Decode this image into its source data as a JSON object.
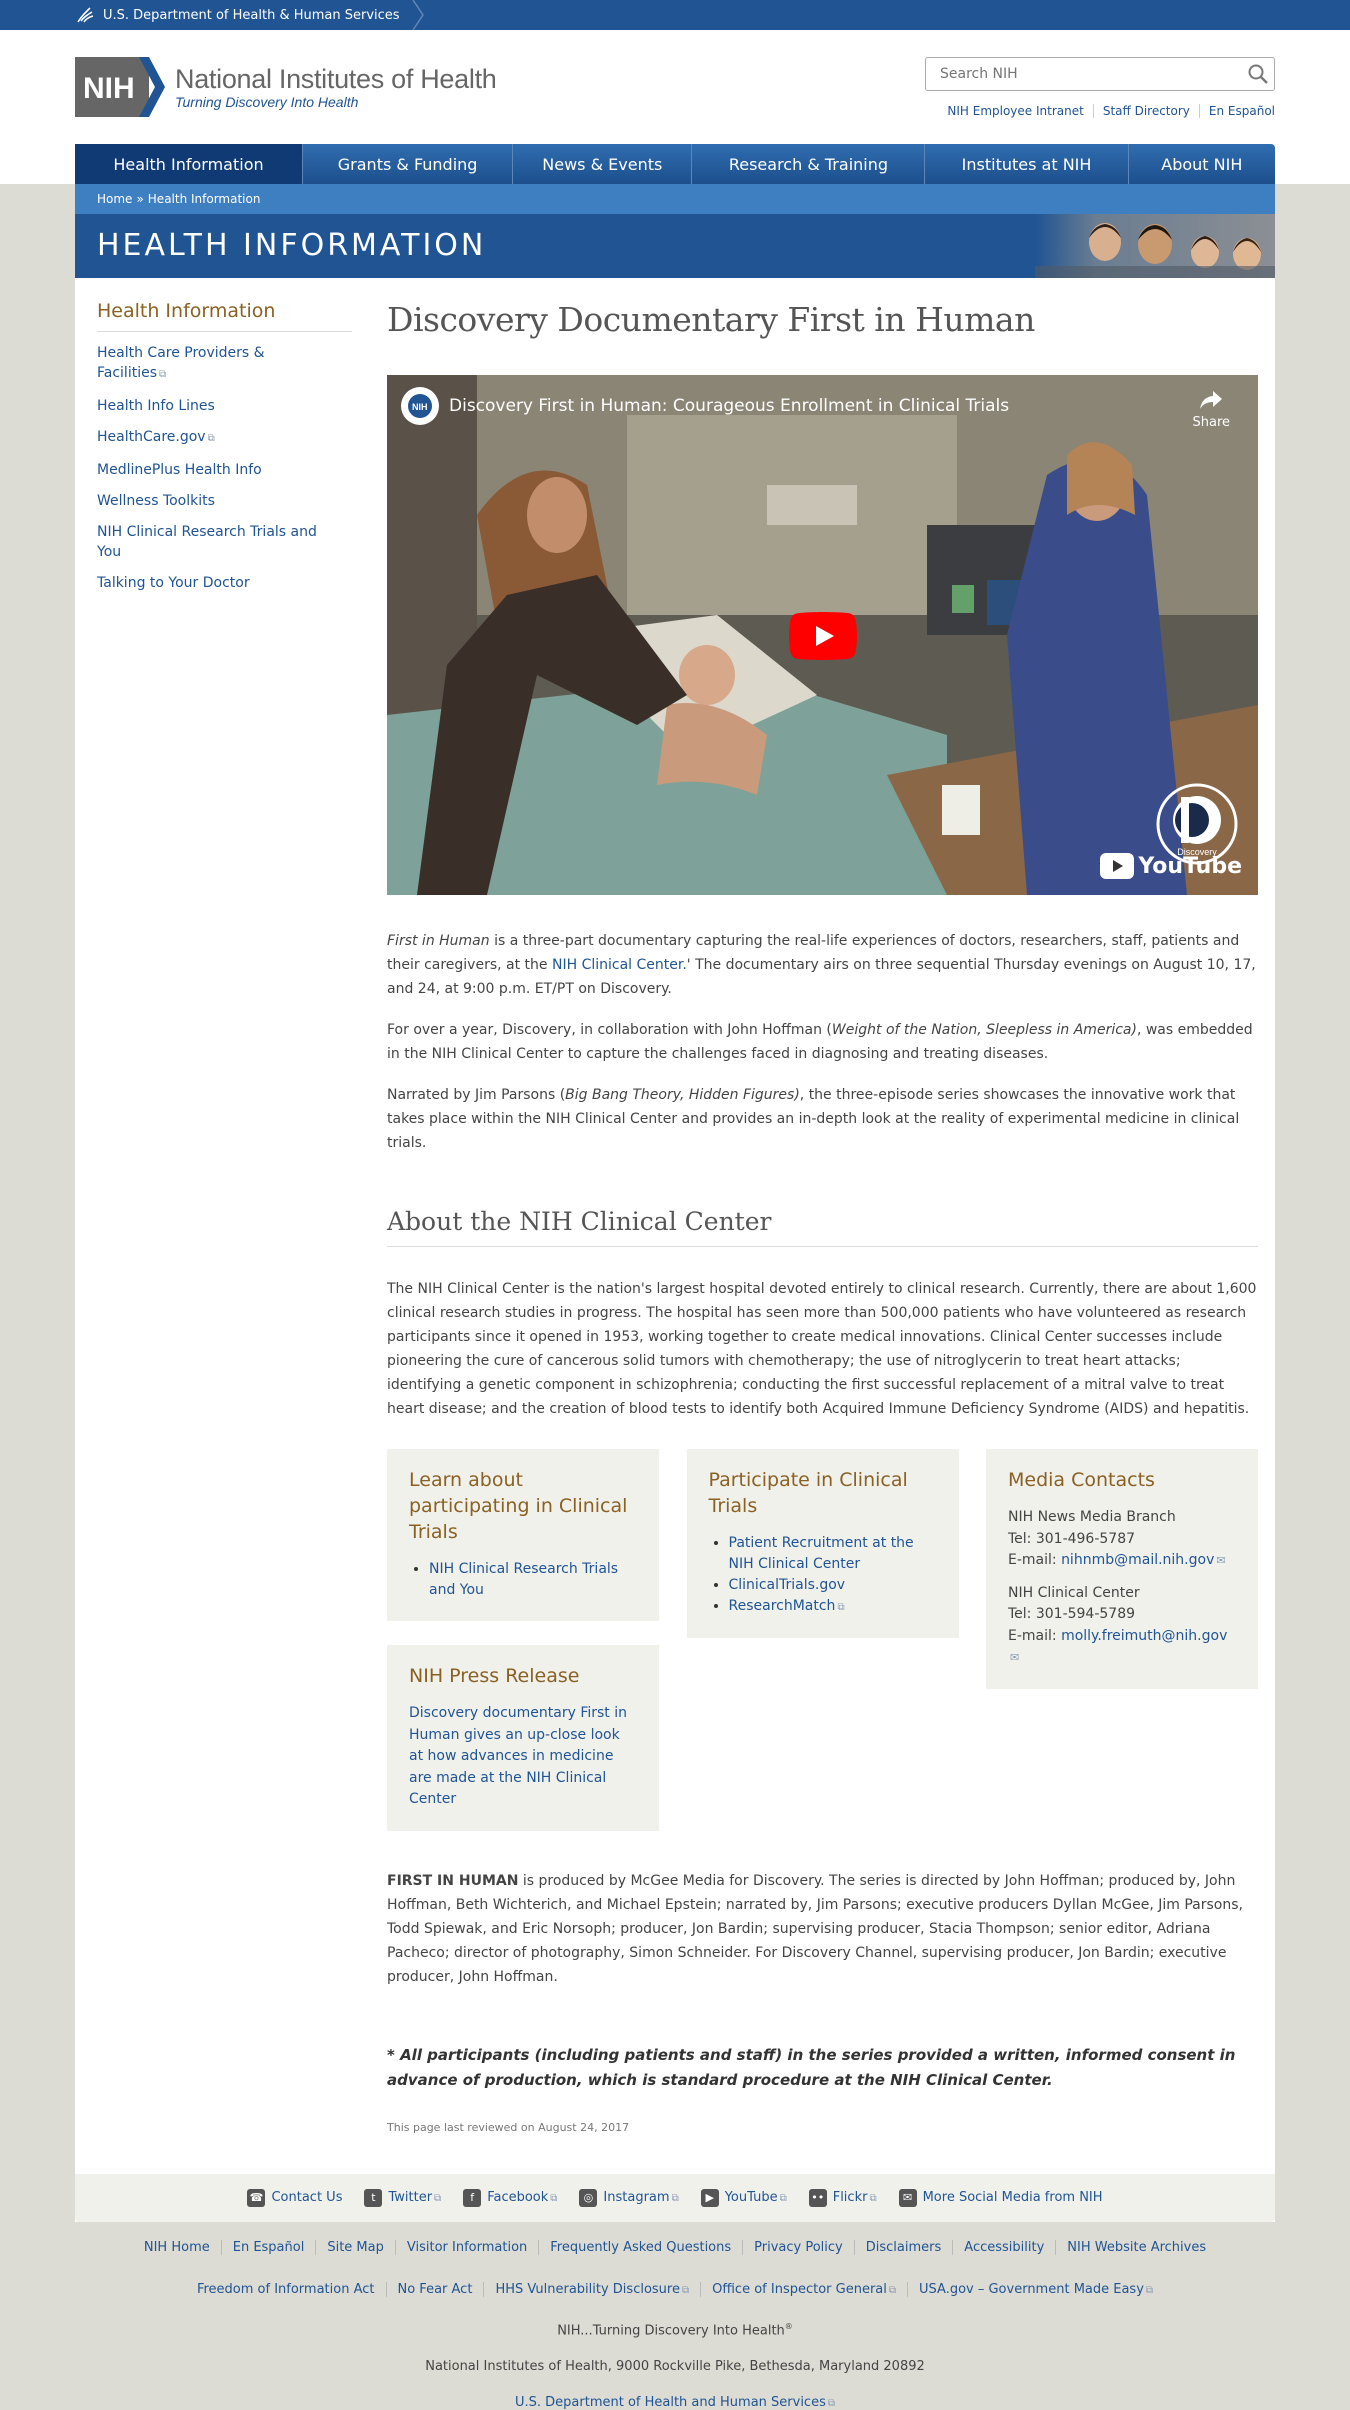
{
  "hhs_bar": {
    "label": "U.S. Department of Health & Human Services"
  },
  "header": {
    "logo_abbr": "NIH",
    "logo_title": "National Institutes of Health",
    "logo_tagline": "Turning Discovery Into Health",
    "search_placeholder": "Search NIH",
    "util_links": [
      "NIH Employee Intranet",
      "Staff Directory",
      "En Español"
    ]
  },
  "nav": {
    "items": [
      "Health Information",
      "Grants & Funding",
      "News & Events",
      "Research & Training",
      "Institutes at NIH",
      "About NIH"
    ],
    "active": "Health Information"
  },
  "breadcrumb": {
    "home": "Home",
    "separator": "»",
    "current": "Health Information"
  },
  "banner": {
    "title": "HEALTH INFORMATION"
  },
  "sidebar": {
    "title": "Health Information",
    "items": [
      {
        "label": "Health Care Providers & Facilities",
        "external": true
      },
      {
        "label": "Health Info Lines",
        "external": false
      },
      {
        "label": "HealthCare.gov",
        "external": true
      },
      {
        "label": "MedlinePlus Health Info",
        "external": false
      },
      {
        "label": "Wellness Toolkits",
        "external": false
      },
      {
        "label": "NIH Clinical Research Trials and You",
        "external": false
      },
      {
        "label": "Talking to Your Doctor",
        "external": false
      }
    ]
  },
  "main": {
    "title": "Discovery Documentary First in Human",
    "video": {
      "title": "Discovery First in Human: Courageous Enrollment in Clinical Trials",
      "share_label": "Share",
      "channel_badge": "Discovery",
      "youtube_label": "YouTube"
    },
    "p1": {
      "italic": "First in Human",
      "text1": " is a three-part documentary capturing the real-life experiences of doctors, researchers, staff, patients and their caregivers, at the ",
      "link": "NIH Clinical Center.",
      "text2": "' The documentary airs on three sequential Thursday evenings on August 10, 17, and 24, at 9:00 p.m. ET/PT on Discovery."
    },
    "p2": {
      "text1": "For over a year, Discovery, in collaboration with John Hoffman (",
      "italic": "Weight of the Nation, Sleepless in America)",
      "text2": ", was embedded in the NIH Clinical Center to capture the challenges faced in diagnosing and treating diseases."
    },
    "p3": {
      "text1": "Narrated by Jim Parsons (",
      "italic": "Big Bang Theory, Hidden Figures)",
      "text2": ", the three-episode series showcases the innovative work that takes place within the NIH Clinical Center and provides an in-depth look at the reality of experimental medicine in clinical trials."
    },
    "about_heading": "About the NIH Clinical Center",
    "about_text": "The NIH Clinical Center is the nation's largest hospital devoted entirely to clinical research. Currently, there are about 1,600 clinical research studies in progress. The hospital has seen more than 500,000 patients who have volunteered as research participants since it opened in 1953, working together to create medical innovations. Clinical Center successes include pioneering the cure of cancerous solid tumors with chemotherapy; the use of nitroglycerin to treat heart attacks; identifying a genetic component in schizophrenia; conducting the first successful replacement of a mitral valve to treat heart disease; and the creation of blood tests to identify both Acquired Immune Deficiency Syndrome (AIDS) and hepatitis.",
    "box_learn": {
      "title": "Learn about participating in Clinical Trials",
      "links": [
        "NIH Clinical Research Trials and You"
      ]
    },
    "box_press": {
      "title": "NIH Press Release",
      "link": "Discovery documentary First in Human gives an up-close look at how advances in medicine are made at the NIH Clinical Center"
    },
    "box_participate": {
      "title": "Participate in Clinical Trials",
      "links": [
        {
          "label": "Patient Recruitment at the NIH Clinical Center",
          "external": false
        },
        {
          "label": "ClinicalTrials.gov",
          "external": false
        },
        {
          "label": "ResearchMatch",
          "external": true
        }
      ]
    },
    "box_media": {
      "title": "Media Contacts",
      "contacts": [
        {
          "name": "NIH News Media Branch",
          "tel": "Tel: 301-496-5787",
          "email_label": "E-mail: ",
          "email": "nihnmb@mail.nih.gov"
        },
        {
          "name": "NIH Clinical Center",
          "tel": "Tel: 301-594-5789",
          "email_label": "E-mail: ",
          "email": "molly.freimuth@nih.gov"
        }
      ]
    },
    "credits": {
      "bold": "FIRST IN HUMAN",
      "text": " is produced by McGee Media for Discovery. The series is directed by John Hoffman; produced by, John Hoffman, Beth Wichterich, and Michael Epstein; narrated by, Jim Parsons; executive producers Dyllan McGee, Jim Parsons, Todd Spiewak, and Eric Norsoph; producer, Jon Bardin; supervising producer, Stacia Thompson; senior editor, Adriana Pacheco; director of photography, Simon Schneider. For Discovery Channel, supervising producer, Jon Bardin; executive producer, John Hoffman."
    },
    "disclaimer": "* All participants (including patients and staff) in the series provided a written, informed consent in advance of production, which is standard procedure at the NIH Clinical Center.",
    "reviewed": "This page last reviewed on August 24, 2017"
  },
  "social": {
    "items": [
      {
        "label": "Contact Us",
        "icon": "phone-icon",
        "glyph": "☎",
        "external": false
      },
      {
        "label": "Twitter",
        "icon": "twitter-icon",
        "glyph": "t",
        "external": true
      },
      {
        "label": "Facebook",
        "icon": "facebook-icon",
        "glyph": "f",
        "external": true
      },
      {
        "label": "Instagram",
        "icon": "instagram-icon",
        "glyph": "◎",
        "external": true
      },
      {
        "label": "YouTube",
        "icon": "youtube-icon",
        "glyph": "▶",
        "external": true
      },
      {
        "label": "Flickr",
        "icon": "flickr-icon",
        "glyph": "••",
        "external": true
      },
      {
        "label": "More Social Media from NIH",
        "icon": "chat-icon",
        "glyph": "✉",
        "external": false
      }
    ]
  },
  "footer": {
    "row1": [
      "NIH Home",
      "En Español",
      "Site Map",
      "Visitor Information",
      "Frequently Asked Questions",
      "Privacy Policy",
      "Disclaimers",
      "Accessibility",
      "NIH Website Archives"
    ],
    "row2": [
      {
        "label": "Freedom of Information Act",
        "external": false
      },
      {
        "label": "No Fear Act",
        "external": false
      },
      {
        "label": "HHS Vulnerability Disclosure",
        "external": true
      },
      {
        "label": "Office of Inspector General",
        "external": true
      },
      {
        "label": "USA.gov – Government Made Easy",
        "external": true
      }
    ],
    "tagline": "NIH...Turning Discovery Into Health",
    "tagline_mark": "®",
    "address": "National Institutes of Health, 9000 Rockville Pike, Bethesda, Maryland 20892",
    "hhs_link": "U.S. Department of Health and Human Services"
  },
  "colors": {
    "brand_blue": "#205493",
    "nav_active": "#0f3a74",
    "heading_gold": "#8a6123",
    "box_bg": "#f1f1ec",
    "page_bg": "#dcdcd4"
  }
}
